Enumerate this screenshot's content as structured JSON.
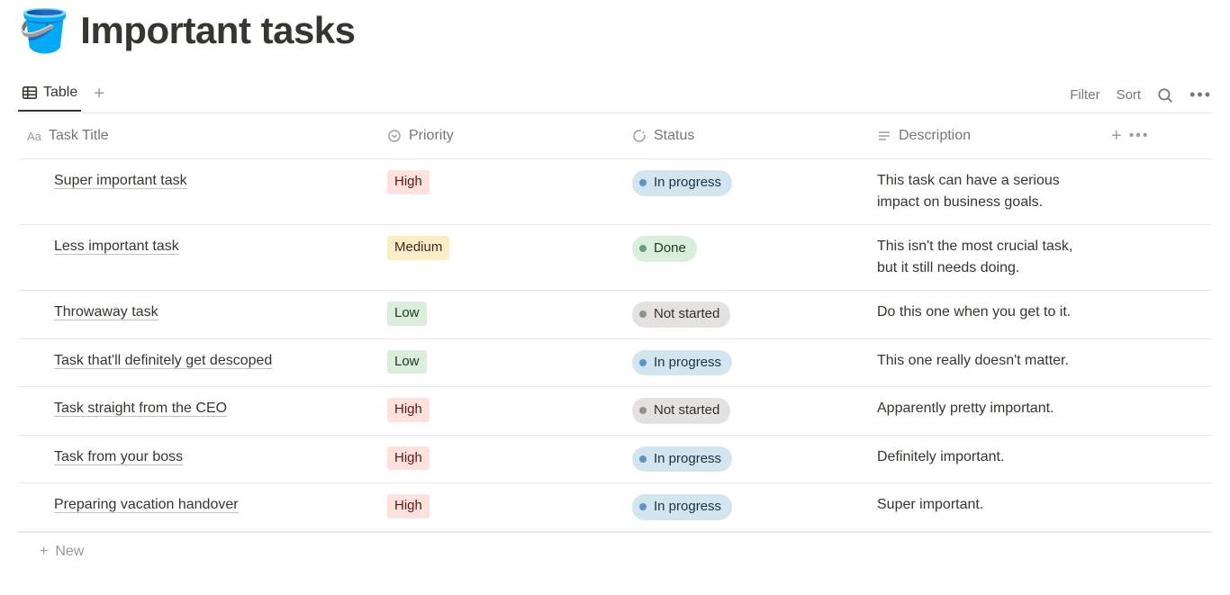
{
  "page": {
    "icon": "🪣",
    "title": "Important tasks"
  },
  "views": {
    "active_tab": "Table",
    "filter_label": "Filter",
    "sort_label": "Sort"
  },
  "columns": {
    "title": "Task Title",
    "priority": "Priority",
    "status": "Status",
    "description": "Description"
  },
  "priority_colors": {
    "High": "#ffe2dd",
    "Medium": "#fdecc8",
    "Low": "#dbeddb"
  },
  "status_colors": {
    "In progress": "#d3e5ef",
    "Done": "#dbeddb",
    "Not started": "#e3e2e0"
  },
  "rows": [
    {
      "title": "Super important task",
      "priority": "High",
      "status": "In progress",
      "description": "This task can have a serious impact on business goals."
    },
    {
      "title": "Less important task",
      "priority": "Medium",
      "status": "Done",
      "description": "This isn't the most crucial task, but it still needs doing."
    },
    {
      "title": "Throwaway task",
      "priority": "Low",
      "status": "Not started",
      "description": "Do this one when you get to it."
    },
    {
      "title": "Task that'll definitely get descoped",
      "priority": "Low",
      "status": "In progress",
      "description": "This one really doesn't matter."
    },
    {
      "title": "Task straight from the CEO",
      "priority": "High",
      "status": "Not started",
      "description": "Apparently pretty important."
    },
    {
      "title": "Task from your boss",
      "priority": "High",
      "status": "In progress",
      "description": "Definitely important."
    },
    {
      "title": "Preparing vacation handover",
      "priority": "High",
      "status": "In progress",
      "description": "Super important."
    }
  ],
  "footer": {
    "new_label": "New"
  }
}
